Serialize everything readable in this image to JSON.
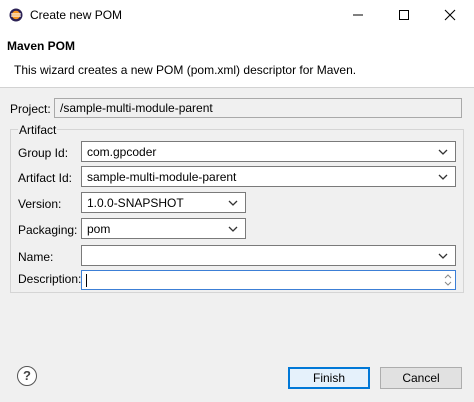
{
  "window": {
    "title": "Create new POM",
    "icon": "eclipse-icon"
  },
  "header": {
    "title": "Maven POM",
    "description": "This wizard creates a new POM (pom.xml) descriptor for Maven."
  },
  "project": {
    "label": "Project:",
    "value": "/sample-multi-module-parent"
  },
  "artifact": {
    "legend": "Artifact",
    "group_id": {
      "label": "Group Id:",
      "value": "com.gpcoder"
    },
    "artifact_id": {
      "label": "Artifact Id:",
      "value": "sample-multi-module-parent"
    },
    "version": {
      "label": "Version:",
      "value": "1.0.0-SNAPSHOT"
    },
    "packaging": {
      "label": "Packaging:",
      "value": "pom"
    },
    "name": {
      "label": "Name:",
      "value": ""
    },
    "description": {
      "label": "Description:",
      "value": ""
    }
  },
  "buttons": {
    "help": "?",
    "finish": "Finish",
    "cancel": "Cancel"
  }
}
